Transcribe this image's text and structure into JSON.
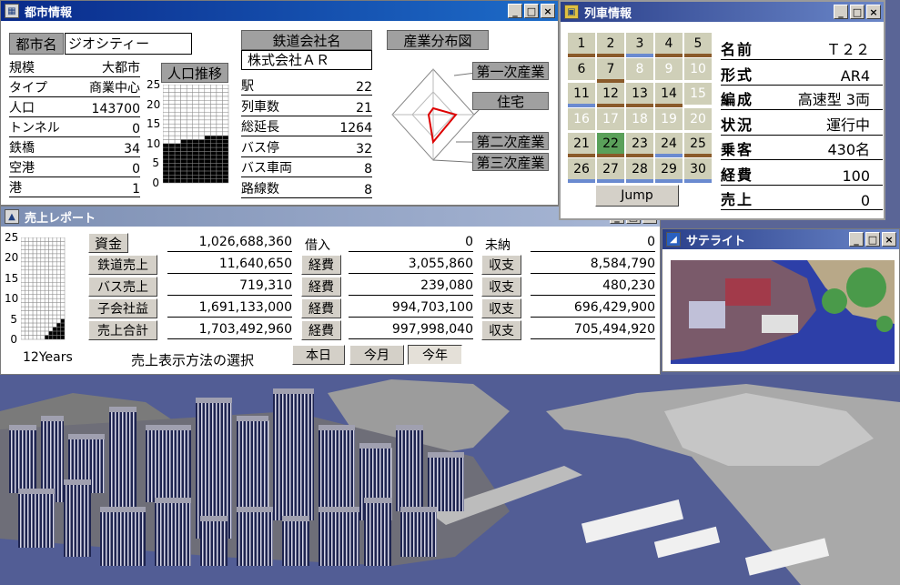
{
  "city_window": {
    "title": "都市情報",
    "city_label": "都市名",
    "city_name": "ジオシティー",
    "stats": [
      {
        "k": "規模",
        "v": "大都市"
      },
      {
        "k": "タイプ",
        "v": "商業中心"
      },
      {
        "k": "人口",
        "v": "143700"
      },
      {
        "k": "トンネル",
        "v": "0"
      },
      {
        "k": "鉄橋",
        "v": "34"
      },
      {
        "k": "空港",
        "v": "0"
      },
      {
        "k": "港",
        "v": "1"
      }
    ],
    "pop_title": "人口推移",
    "pop_axis": [
      "25",
      "20",
      "15",
      "10",
      "5",
      "0"
    ],
    "pop_levels": [
      10,
      10,
      10,
      11,
      11,
      11,
      11,
      12,
      12,
      12,
      12
    ],
    "company_label": "鉄道会社名",
    "company_name": "株式会社ＡＲ",
    "company_stats": [
      {
        "k": "駅",
        "v": "22"
      },
      {
        "k": "列車数",
        "v": "21"
      },
      {
        "k": "総延長",
        "v": "1264"
      },
      {
        "k": "バス停",
        "v": "32"
      },
      {
        "k": "バス車両",
        "v": "8"
      },
      {
        "k": "路線数",
        "v": "8"
      }
    ],
    "industry_title": "産業分布図",
    "industry_labels": [
      "第一次産業",
      "住宅",
      "第二次産業",
      "第三次産業"
    ]
  },
  "train_window": {
    "title": "列車情報",
    "cells": [
      {
        "n": "1",
        "bar": "#8a5a2a",
        "dim": false
      },
      {
        "n": "2",
        "bar": "#8a5a2a",
        "dim": false
      },
      {
        "n": "3",
        "bar": "#6a8ad0",
        "dim": false
      },
      {
        "n": "4",
        "bar": "#8a5a2a",
        "dim": false
      },
      {
        "n": "5",
        "bar": "#8a5a2a",
        "dim": false
      },
      {
        "n": "6",
        "bar": "",
        "dim": false
      },
      {
        "n": "7",
        "bar": "#8a5a2a",
        "dim": false
      },
      {
        "n": "8",
        "bar": "",
        "dim": true
      },
      {
        "n": "9",
        "bar": "",
        "dim": true
      },
      {
        "n": "10",
        "bar": "",
        "dim": true
      },
      {
        "n": "11",
        "bar": "#6a8ad0",
        "dim": false
      },
      {
        "n": "12",
        "bar": "#8a5a2a",
        "dim": false
      },
      {
        "n": "13",
        "bar": "#8a5a2a",
        "dim": false
      },
      {
        "n": "14",
        "bar": "#8a5a2a",
        "dim": false
      },
      {
        "n": "15",
        "bar": "",
        "dim": true
      },
      {
        "n": "16",
        "bar": "",
        "dim": true
      },
      {
        "n": "17",
        "bar": "",
        "dim": true
      },
      {
        "n": "18",
        "bar": "",
        "dim": true
      },
      {
        "n": "19",
        "bar": "",
        "dim": true
      },
      {
        "n": "20",
        "bar": "",
        "dim": true
      },
      {
        "n": "21",
        "bar": "#8a5a2a",
        "dim": false
      },
      {
        "n": "22",
        "bar": "#8a5a2a",
        "dim": false,
        "selected": true
      },
      {
        "n": "23",
        "bar": "#8a5a2a",
        "dim": false
      },
      {
        "n": "24",
        "bar": "#6a8ad0",
        "dim": false
      },
      {
        "n": "25",
        "bar": "#8a5a2a",
        "dim": false
      },
      {
        "n": "26",
        "bar": "#6a8ad0",
        "dim": false
      },
      {
        "n": "27",
        "bar": "#6a8ad0",
        "dim": false
      },
      {
        "n": "28",
        "bar": "#6a8ad0",
        "dim": false
      },
      {
        "n": "29",
        "bar": "#6a8ad0",
        "dim": false
      },
      {
        "n": "30",
        "bar": "#6a8ad0",
        "dim": false
      }
    ],
    "jump_label": "Jump",
    "details": [
      {
        "k": "名前",
        "v": "Ｔ２２"
      },
      {
        "k": "形式",
        "v": "AR4"
      },
      {
        "k": "編成",
        "v": "高速型 3両"
      },
      {
        "k": "状況",
        "v": "運行中"
      },
      {
        "k": "乗客",
        "v": "430名"
      },
      {
        "k": "経費",
        "v": "100"
      },
      {
        "k": "売上",
        "v": "0"
      }
    ]
  },
  "sales_window": {
    "title": "売上レポート",
    "axis": [
      "25",
      "20",
      "15",
      "10",
      "5",
      "0"
    ],
    "levels": [
      0,
      0,
      0,
      0,
      0,
      0,
      1,
      2,
      3,
      4,
      5
    ],
    "years_label": "12Years",
    "rows": [
      {
        "label": "資金",
        "value": "1,026,688,360",
        "mid_label": "借入",
        "mid_value": "0",
        "right_label": "未納",
        "right_value": "0"
      },
      {
        "label": "鉄道売上",
        "value": "11,640,650",
        "mid_label": "経費",
        "mid_value": "3,055,860",
        "right_label": "収支",
        "right_value": "8,584,790"
      },
      {
        "label": "バス売上",
        "value": "719,310",
        "mid_label": "経費",
        "mid_value": "239,080",
        "right_label": "収支",
        "right_value": "480,230"
      },
      {
        "label": "子会社益",
        "value": "1,691,133,000",
        "mid_label": "経費",
        "mid_value": "994,703,100",
        "right_label": "収支",
        "right_value": "696,429,900"
      },
      {
        "label": "売上合計",
        "value": "1,703,492,960",
        "mid_label": "経費",
        "mid_value": "997,998,040",
        "right_label": "収支",
        "right_value": "705,494,920"
      }
    ],
    "display_method": "売上表示方法の選択",
    "period_buttons": [
      "本日",
      "今月",
      "今年"
    ]
  },
  "satellite_window": {
    "title": "サテライト"
  },
  "colors": {
    "title_active": "#0a2a8a",
    "water": "#505c94",
    "label_gray": "#a0a0a0"
  }
}
